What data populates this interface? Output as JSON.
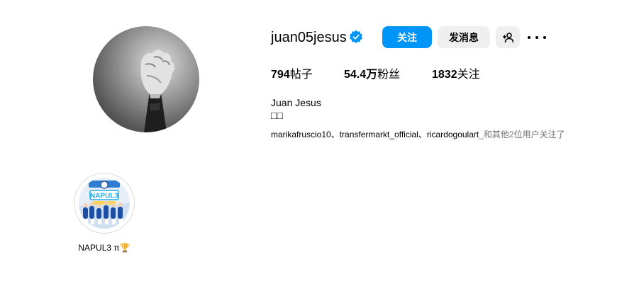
{
  "profile": {
    "username": "juan05jesus",
    "verified": true,
    "full_name": "Juan Jesus",
    "bio": "□□",
    "avatar_icon": "raised-fist-photo"
  },
  "actions": {
    "follow_label": "关注",
    "message_label": "发消息",
    "add_user_icon": "person-plus-icon",
    "more_icon": "more-horizontal-icon"
  },
  "stats": {
    "posts_value": "794",
    "posts_label": "帖子",
    "followers_value": "54.4万",
    "followers_label": "粉丝",
    "following_value": "1832",
    "following_label": "关注"
  },
  "followed_by": {
    "names": "marikafruscio10、transfermarkt_official、ricardogoulart",
    "rest": "_和其他2位用户关注了"
  },
  "highlights": [
    {
      "label": "NAPUL3 π🏆",
      "image_text": "NAPUL3"
    }
  ],
  "colors": {
    "accent": "#0095f6",
    "secondary_button": "#efefef",
    "muted_text": "#737373"
  }
}
